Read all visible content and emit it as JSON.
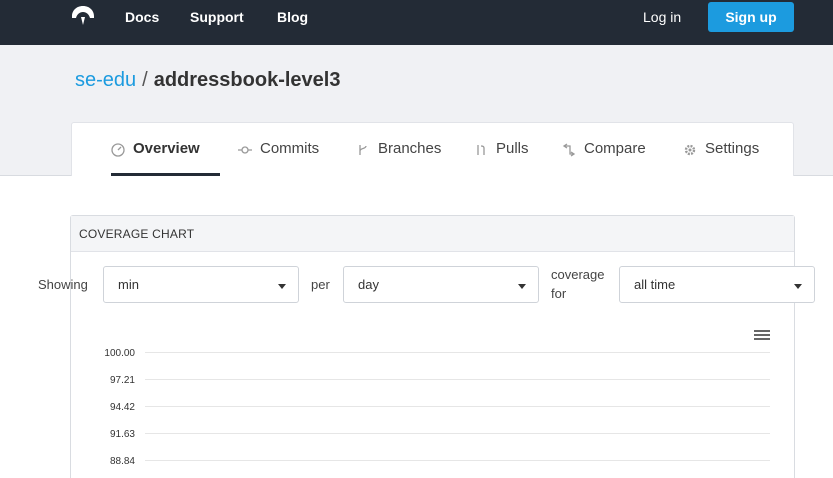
{
  "nav": {
    "links": [
      "Docs",
      "Support",
      "Blog"
    ],
    "login_label": "Log in",
    "signup_label": "Sign up"
  },
  "repo": {
    "owner": "se-edu",
    "separator": "/",
    "name": "addressbook-level3"
  },
  "tabs": [
    {
      "label": "Overview",
      "icon": "gauge-icon",
      "active": true
    },
    {
      "label": "Commits",
      "icon": "commit-icon",
      "active": false
    },
    {
      "label": "Branches",
      "icon": "branch-icon",
      "active": false
    },
    {
      "label": "Pulls",
      "icon": "pull-request-icon",
      "active": false
    },
    {
      "label": "Compare",
      "icon": "compare-icon",
      "active": false
    },
    {
      "label": "Settings",
      "icon": "gear-icon",
      "active": false
    }
  ],
  "coverage_card": {
    "title": "COVERAGE CHART",
    "showing_label": "Showing",
    "showing_value": "min",
    "per_label": "per",
    "per_value": "day",
    "coverage_for_label": "coverage for",
    "range_value": "all time"
  },
  "colors": {
    "nav_bg": "#232b36",
    "accent": "#1c9bdf"
  },
  "chart_data": {
    "type": "line",
    "y_ticks": [
      "100.00",
      "97.21",
      "94.42",
      "91.63",
      "88.84"
    ],
    "ylim": [
      88.84,
      100.0
    ],
    "grid": true,
    "series": []
  }
}
